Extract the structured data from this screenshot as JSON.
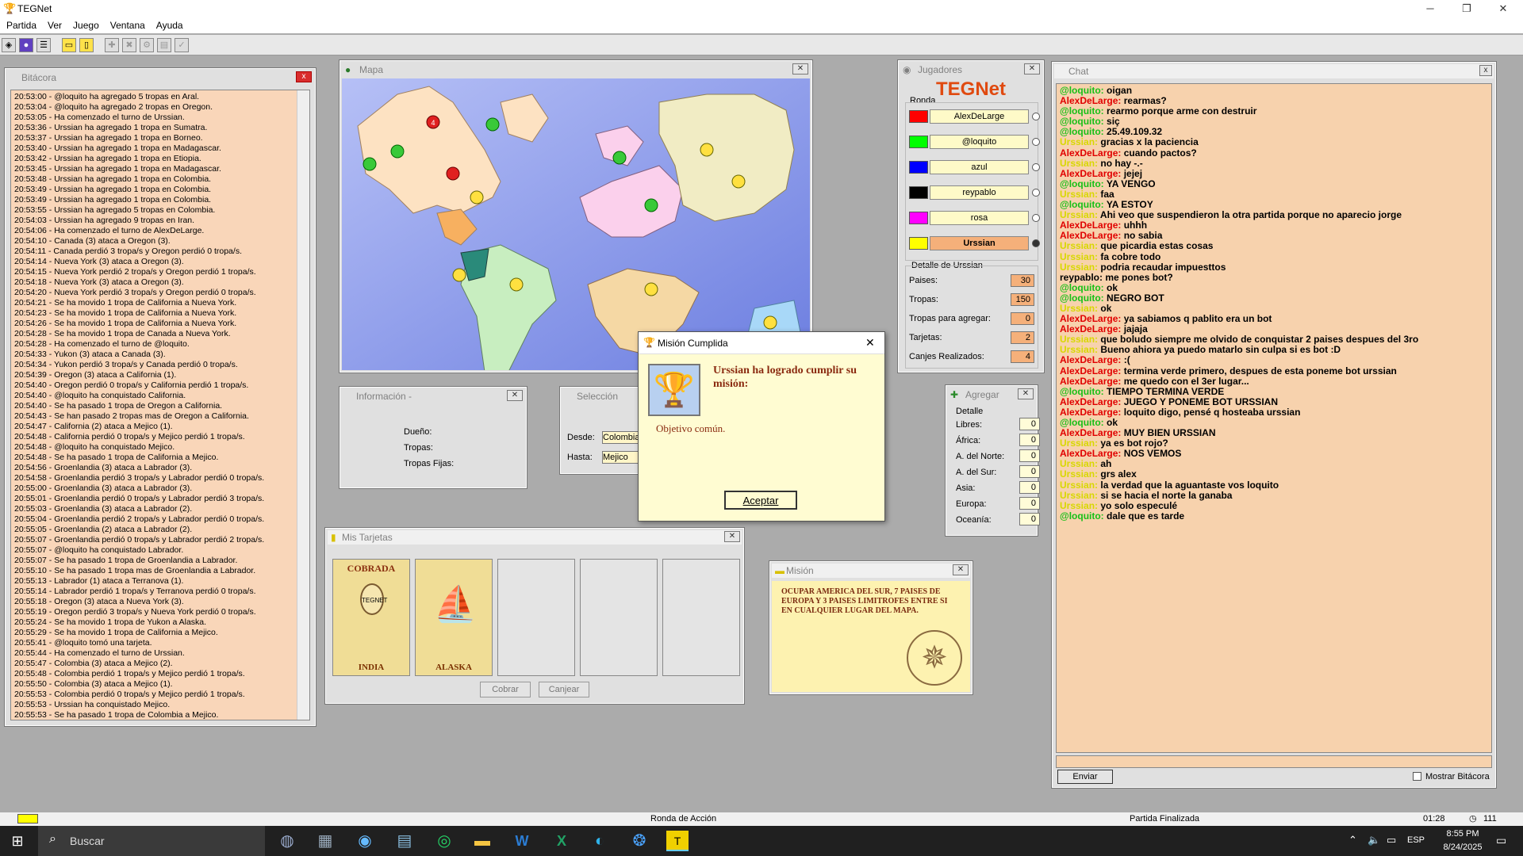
{
  "app": {
    "title": "TEGNet"
  },
  "menu": [
    "Partida",
    "Ver",
    "Juego",
    "Ventana",
    "Ayuda"
  ],
  "bitacora": {
    "title": "Bitácora",
    "lines": [
      "20:53:00 - @loquito ha agregado 5 tropas en Aral.",
      "20:53:04 - @loquito ha agregado 2 tropas en Oregon.",
      "20:53:05 - Ha comenzado el turno de Urssian.",
      "20:53:36 - Urssian ha agregado 1 tropa en Sumatra.",
      "20:53:37 - Urssian ha agregado 1 tropa en Borneo.",
      "20:53:40 - Urssian ha agregado 1 tropa en Madagascar.",
      "20:53:42 - Urssian ha agregado 1 tropa en Etiopia.",
      "20:53:45 - Urssian ha agregado 1 tropa en Madagascar.",
      "20:53:48 - Urssian ha agregado 1 tropa en Colombia.",
      "20:53:49 - Urssian ha agregado 1 tropa en Colombia.",
      "20:53:49 - Urssian ha agregado 1 tropa en Colombia.",
      "20:53:55 - Urssian ha agregado 5 tropas en Colombia.",
      "20:54:03 - Urssian ha agregado 9 tropas en Iran.",
      "20:54:06 - Ha comenzado el turno de AlexDeLarge.",
      "20:54:10 - Canada (3) ataca a Oregon (3).",
      "20:54:11 - Canada perdió 3 tropa/s y Oregon perdió 0 tropa/s.",
      "20:54:14 - Nueva York (3) ataca a Oregon (3).",
      "20:54:15 - Nueva York perdió 2 tropa/s y Oregon perdió 1 tropa/s.",
      "20:54:18 - Nueva York (3) ataca a Oregon (3).",
      "20:54:20 - Nueva York perdió 3 tropa/s y Oregon perdió 0 tropa/s.",
      "20:54:21 - Se ha movido 1 tropa de California a Nueva York.",
      "20:54:23 - Se ha movido 1 tropa de California a Nueva York.",
      "20:54:26 - Se ha movido 1 tropa de California a Nueva York.",
      "20:54:28 - Se ha movido 1 tropa de Canada a Nueva York.",
      "20:54:28 - Ha comenzado el turno de @loquito.",
      "20:54:33 - Yukon (3) ataca a Canada (3).",
      "20:54:34 - Yukon perdió 3 tropa/s y Canada perdió 0 tropa/s.",
      "20:54:39 - Oregon (3) ataca a California (1).",
      "20:54:40 - Oregon perdió 0 tropa/s y California perdió 1 tropa/s.",
      "20:54:40 - @loquito ha conquistado California.",
      "20:54:40 - Se ha pasado 1 tropa de Oregon a California.",
      "20:54:43 - Se han pasado 2 tropas mas de Oregon a California.",
      "20:54:47 - California (2) ataca a Mejico (1).",
      "20:54:48 - California perdió 0 tropa/s y Mejico perdió 1 tropa/s.",
      "20:54:48 - @loquito ha conquistado Mejico.",
      "20:54:48 - Se ha pasado 1 tropa de California a Mejico.",
      "20:54:56 - Groenlandia (3) ataca a Labrador (3).",
      "20:54:58 - Groenlandia perdió 3 tropa/s y Labrador perdió 0 tropa/s.",
      "20:55:00 - Groenlandia (3) ataca a Labrador (3).",
      "20:55:01 - Groenlandia perdió 0 tropa/s y Labrador perdió 3 tropa/s.",
      "20:55:03 - Groenlandia (3) ataca a Labrador (2).",
      "20:55:04 - Groenlandia perdió 2 tropa/s y Labrador perdió 0 tropa/s.",
      "20:55:05 - Groenlandia (2) ataca a Labrador (2).",
      "20:55:07 - Groenlandia perdió 0 tropa/s y Labrador perdió 2 tropa/s.",
      "20:55:07 - @loquito ha conquistado Labrador.",
      "20:55:07 - Se ha pasado 1 tropa de Groenlandia a Labrador.",
      "20:55:10 - Se ha pasado 1 tropa mas de Groenlandia a Labrador.",
      "20:55:13 - Labrador (1) ataca a Terranova (1).",
      "20:55:14 - Labrador perdió 1 tropa/s y Terranova perdió 0 tropa/s.",
      "20:55:18 - Oregon (3) ataca a Nueva York (3).",
      "20:55:19 - Oregon perdió 3 tropa/s y Nueva York perdió 0 tropa/s.",
      "20:55:24 - Se ha movido 1 tropa de Yukon a Alaska.",
      "20:55:29 - Se ha movido 1 tropa de California a Mejico.",
      "20:55:41 - @loquito tomó una tarjeta.",
      "20:55:44 - Ha comenzado el turno de Urssian.",
      "20:55:47 - Colombia (3) ataca a Mejico (2).",
      "20:55:48 - Colombia perdió 1 tropa/s y Mejico perdió 1 tropa/s.",
      "20:55:50 - Colombia (3) ataca a Mejico (1).",
      "20:55:53 - Colombia perdió 0 tropa/s y Mejico perdió 1 tropa/s.",
      "20:55:53 - Urssian ha conquistado Mejico.",
      "20:55:53 - Se ha pasado 1 tropa de Colombia a Mejico."
    ]
  },
  "mapa": {
    "title": "Mapa"
  },
  "informacion": {
    "title": "Información -",
    "dueno": "Dueño:",
    "tropas": "Tropas:",
    "tropas_fijas": "Tropas Fijas:"
  },
  "seleccion": {
    "title": "Selección",
    "desde_label": "Desde:",
    "desde": "Colombia",
    "hasta_label": "Hasta:",
    "hasta": "Mejico"
  },
  "tarjetas": {
    "title": "Mis Tarjetas",
    "cards": [
      {
        "top": "COBRADA",
        "logo": "TEGNET",
        "name": "INDIA"
      },
      {
        "top": "",
        "logo": "",
        "name": "ALASKA"
      }
    ],
    "cobrar": "Cobrar",
    "canjear": "Canjear"
  },
  "mision": {
    "title": "Misión",
    "text": "OCUPAR AMERICA DEL SUR, 7 PAISES DE EUROPA Y 3 PAISES LIMITROFES ENTRE SI EN CUALQUIER LUGAR DEL MAPA."
  },
  "dialog": {
    "title": "Misión Cumplida",
    "heading": "Urssian ha logrado cumplir su misión:",
    "body": "Objetivo común.",
    "button": "Aceptar"
  },
  "jugadores": {
    "title": "Jugadores",
    "logo": "TEGNet",
    "ronda": "Ronda",
    "players": [
      {
        "name": "AlexDeLarge",
        "color": "#ff0000"
      },
      {
        "name": "@loquito",
        "color": "#00ff00"
      },
      {
        "name": "azul",
        "color": "#0000ff"
      },
      {
        "name": "reypablo",
        "color": "#000000"
      },
      {
        "name": "rosa",
        "color": "#ff00ff"
      },
      {
        "name": "Urssian",
        "color": "#ffff00"
      }
    ],
    "detalle_title": "Detalle de Urssian",
    "detalle": [
      {
        "label": "Paises:",
        "value": "30"
      },
      {
        "label": "Tropas:",
        "value": "150"
      },
      {
        "label": "Tropas para agregar:",
        "value": "0"
      },
      {
        "label": "Tarjetas:",
        "value": "2"
      },
      {
        "label": "Canjes Realizados:",
        "value": "4"
      }
    ]
  },
  "agregar": {
    "title": "Agregar",
    "detalle": "Detalle",
    "rows": [
      {
        "label": "Libres:",
        "value": "0"
      },
      {
        "label": "África:",
        "value": "0"
      },
      {
        "label": "A. del Norte:",
        "value": "0"
      },
      {
        "label": "A. del Sur:",
        "value": "0"
      },
      {
        "label": "Asia:",
        "value": "0"
      },
      {
        "label": "Europa:",
        "value": "0"
      },
      {
        "label": "Oceanía:",
        "value": "0"
      }
    ]
  },
  "chat": {
    "title": "Chat",
    "send": "Enviar",
    "mostrar": "Mostrar Bitácora",
    "messages": [
      {
        "n": "@loquito:",
        "c": "g",
        "t": "oigan"
      },
      {
        "n": "AlexDeLarge:",
        "c": "r",
        "t": "rearmas?"
      },
      {
        "n": "@loquito:",
        "c": "g",
        "t": "rearmo porque arme con destruir"
      },
      {
        "n": "@loquito:",
        "c": "g",
        "t": "siç"
      },
      {
        "n": "@loquito:",
        "c": "g",
        "t": "25.49.109.32"
      },
      {
        "n": "Urssian:",
        "c": "y",
        "t": "gracias x la paciencia"
      },
      {
        "n": "AlexDeLarge:",
        "c": "r",
        "t": "cuando pactos?"
      },
      {
        "n": "Urssian:",
        "c": "y",
        "t": "no hay -.-"
      },
      {
        "n": "AlexDeLarge:",
        "c": "r",
        "t": "jejej"
      },
      {
        "n": "@loquito:",
        "c": "g",
        "t": "YA VENGO"
      },
      {
        "n": "Urssian:",
        "c": "y",
        "t": "faa"
      },
      {
        "n": "@loquito:",
        "c": "g",
        "t": "YA ESTOY"
      },
      {
        "n": "Urssian:",
        "c": "y",
        "t": "Ahi veo que suspendieron la otra partida porque no aparecio jorge"
      },
      {
        "n": "AlexDeLarge:",
        "c": "r",
        "t": "uhhh"
      },
      {
        "n": "AlexDeLarge:",
        "c": "r",
        "t": "no sabia"
      },
      {
        "n": "Urssian:",
        "c": "y",
        "t": "que picardia estas cosas"
      },
      {
        "n": "Urssian:",
        "c": "y",
        "t": "fa cobre todo"
      },
      {
        "n": "Urssian:",
        "c": "y",
        "t": "podria recaudar impuesttos"
      },
      {
        "n": "reypablo:",
        "c": "k",
        "t": "me pones bot?"
      },
      {
        "n": "@loquito:",
        "c": "g",
        "t": "ok"
      },
      {
        "n": "@loquito:",
        "c": "g",
        "t": "NEGRO BOT"
      },
      {
        "n": "Urssian:",
        "c": "y",
        "t": "ok"
      },
      {
        "n": "AlexDeLarge:",
        "c": "r",
        "t": "ya sabiamos q pablito era un bot"
      },
      {
        "n": "AlexDeLarge:",
        "c": "r",
        "t": "jajaja"
      },
      {
        "n": "Urssian:",
        "c": "y",
        "t": "que boludo siempre me olvido de conquistar 2 paises despues del 3ro"
      },
      {
        "n": "Urssian:",
        "c": "y",
        "t": "Bueno ahiora ya puedo matarlo sin culpa si es bot :D"
      },
      {
        "n": "AlexDeLarge:",
        "c": "r",
        "t": ":("
      },
      {
        "n": "AlexDeLarge:",
        "c": "r",
        "t": "termina verde primero, despues de esta poneme bot urssian"
      },
      {
        "n": "AlexDeLarge:",
        "c": "r",
        "t": "me quedo con el 3er lugar..."
      },
      {
        "n": "@loquito:",
        "c": "g",
        "t": "TIEMPO TERMINA VERDE"
      },
      {
        "n": "AlexDeLarge:",
        "c": "r",
        "t": "JUEGO Y PONEME BOT URSSIAN"
      },
      {
        "n": "AlexDeLarge:",
        "c": "r",
        "t": "loquito digo, pensé q hosteaba urssian"
      },
      {
        "n": "@loquito:",
        "c": "g",
        "t": "ok"
      },
      {
        "n": "AlexDeLarge:",
        "c": "r",
        "t": "MUY BIEN URSSIAN"
      },
      {
        "n": "Urssian:",
        "c": "y",
        "t": "ya es bot rojo?"
      },
      {
        "n": "AlexDeLarge:",
        "c": "r",
        "t": "NOS VEMOS"
      },
      {
        "n": "Urssian:",
        "c": "y",
        "t": "ah"
      },
      {
        "n": "Urssian:",
        "c": "y",
        "t": "grs alex"
      },
      {
        "n": "Urssian:",
        "c": "y",
        "t": "la verdad que la aguantaste vos loquito"
      },
      {
        "n": "Urssian:",
        "c": "y",
        "t": "si se hacia el norte la ganaba"
      },
      {
        "n": "Urssian:",
        "c": "y",
        "t": "yo solo especulé"
      },
      {
        "n": "@loquito:",
        "c": "g",
        "t": "dale que es tarde"
      }
    ]
  },
  "status": {
    "ronda": "Ronda de Acción",
    "partida": "Partida Finalizada",
    "time": "01:28",
    "count": "111"
  },
  "taskbar": {
    "search": "Buscar",
    "lang": "ESP",
    "time": "8:55 PM",
    "date": "8/24/2025"
  }
}
